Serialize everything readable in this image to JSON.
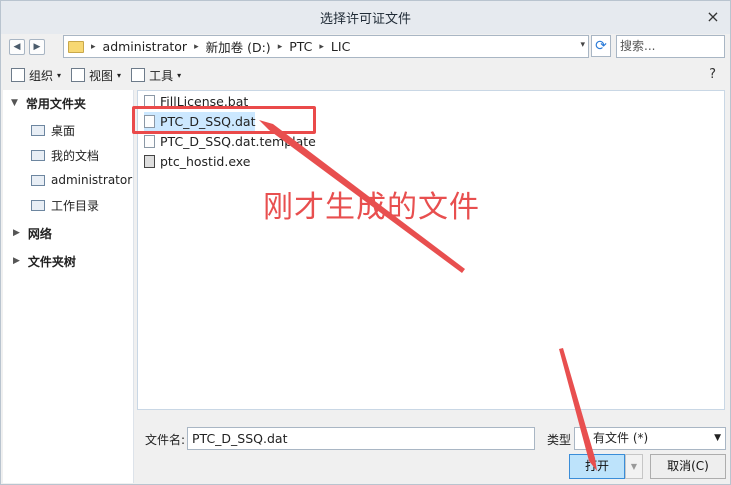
{
  "window": {
    "title": "选择许可证文件",
    "close_glyph": "×"
  },
  "nav": {
    "back": "◀",
    "forward": "▶"
  },
  "address": {
    "crumbs": [
      "administrator",
      "新加卷 (D:)",
      "PTC",
      "LIC"
    ],
    "separator": "▸",
    "dropdown": "▾"
  },
  "refresh_glyph": "⟳",
  "search": {
    "placeholder": "搜索..."
  },
  "toolbar": {
    "organize": "组织",
    "view": "视图",
    "tools": "工具",
    "caret": "▾",
    "help_glyph": "?"
  },
  "sidebar": {
    "favorites": "常用文件夹",
    "items": [
      "桌面",
      "我的文档",
      "administrator",
      "工作目录"
    ],
    "network": "网络",
    "folder_tree": "文件夹树"
  },
  "files": [
    {
      "name": "FillLicense.bat",
      "selected": false
    },
    {
      "name": "PTC_D_SSQ.dat",
      "selected": true
    },
    {
      "name": "PTC_D_SSQ.dat.template",
      "selected": false
    },
    {
      "name": "ptc_hostid.exe",
      "selected": false
    }
  ],
  "annotation": {
    "text": "刚才生成的文件",
    "color": "#e84f4f"
  },
  "bottom": {
    "filename_label": "文件名:",
    "filename_value": "PTC_D_SSQ.dat",
    "type_label": "类型",
    "type_value": "有文件 (*)",
    "open": "打开",
    "cancel": "取消(C)"
  },
  "colors": {
    "accent": "#3a8dd8",
    "selection": "#cce8ff",
    "highlight_box": "#ea4a4a"
  }
}
